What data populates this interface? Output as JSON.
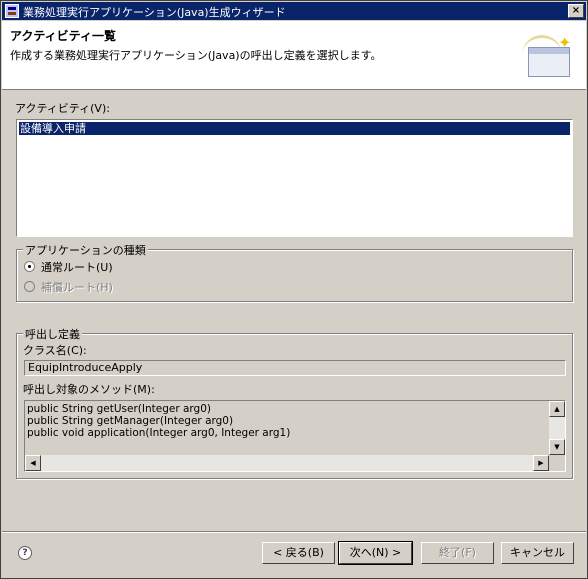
{
  "window": {
    "title": "業務処理実行アプリケーション(Java)生成ウィザード",
    "close_glyph": "×"
  },
  "banner": {
    "title": "アクティビティ一覧",
    "description": "作成する業務処理実行アプリケーション(Java)の呼出し定義を選択します。"
  },
  "activity": {
    "label": "アクティビティ(V):",
    "items": [
      "設備導入申請"
    ]
  },
  "app_type": {
    "title": "アプリケーションの種類",
    "options": [
      {
        "label": "通常ルート(U)",
        "checked": true,
        "enabled": true
      },
      {
        "label": "補償ルート(H)",
        "checked": false,
        "enabled": false
      }
    ]
  },
  "call_def": {
    "title": "呼出し定義",
    "class_label": "クラス名(C):",
    "class_value": "EquipIntroduceApply",
    "method_label": "呼出し対象のメソッド(M):",
    "methods": [
      "public String getUser(Integer arg0)",
      "public String getManager(Integer arg0)",
      "public void application(Integer arg0, Integer arg1)"
    ]
  },
  "scrollbar_glyphs": {
    "up": "▲",
    "down": "▼",
    "left": "◀",
    "right": "▶"
  },
  "footer": {
    "help_glyph": "?",
    "back": "< 戻る(B)",
    "next": "次へ(N) >",
    "finish": "終了(F)",
    "cancel": "キャンセル"
  }
}
